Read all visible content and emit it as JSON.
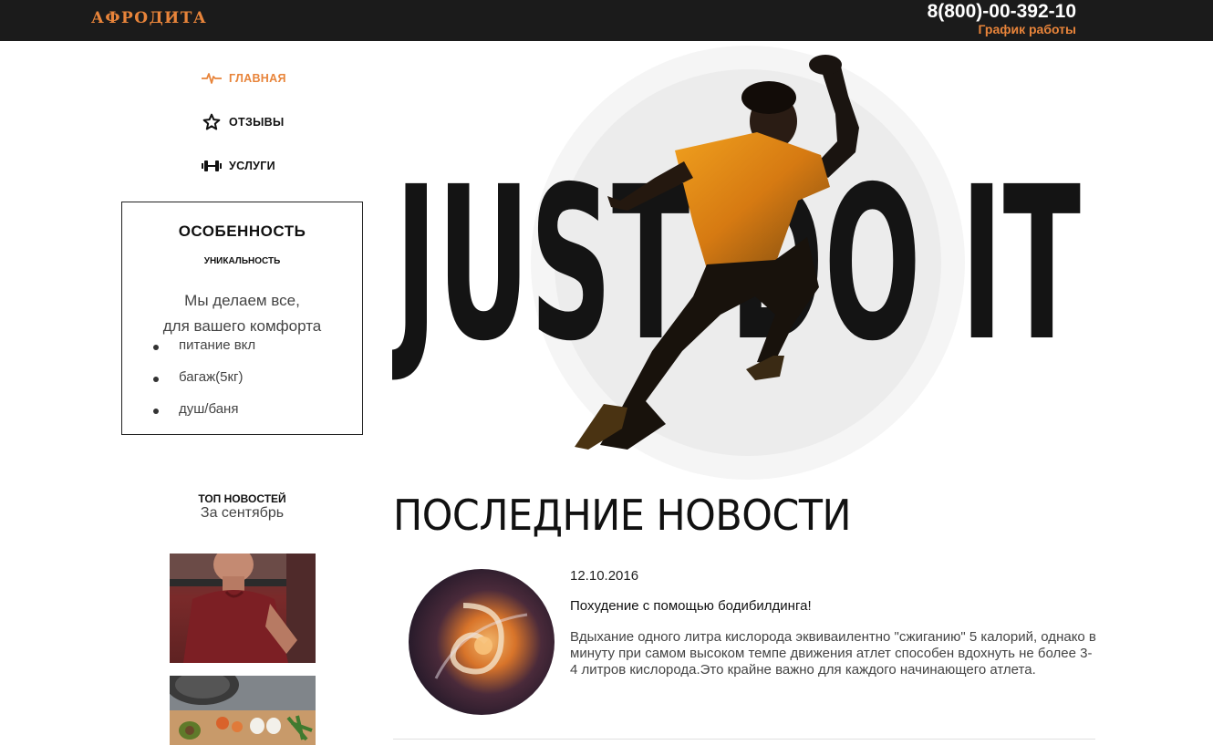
{
  "header": {
    "logo": "АФРОДИТА",
    "phone": "8(800)-00-392-10",
    "schedule_link": "График работы"
  },
  "nav": {
    "items": [
      {
        "label": "ГЛАВНАЯ",
        "icon": "pulse-icon",
        "active": true
      },
      {
        "label": "ОТЗЫВЫ",
        "icon": "star-icon",
        "active": false
      },
      {
        "label": "УСЛУГИ",
        "icon": "dumbbell-icon",
        "active": false
      }
    ]
  },
  "feature": {
    "title": "ОСОБЕННОСТЬ",
    "subtitle": "УНИКАЛЬНОСТЬ",
    "text_line1": "Мы делаем все,",
    "text_line2": "для вашего комфорта",
    "items": [
      "питание вкл",
      "багаж(5кг)",
      "душ/баня"
    ]
  },
  "top_news": {
    "title": "ТОП НОВОСТЕЙ",
    "subtitle": "За сентябрь"
  },
  "hero": {
    "slogan": "JUST DO IT"
  },
  "news": {
    "heading": "ПОСЛЕДНИЕ НОВОСТИ",
    "items": [
      {
        "date": "12.10.2016",
        "title": "Похудение с помощью бодибилдинга!",
        "text": "Вдыхание одного литра кислорода эквиваилентно \"сжиганию\" 5 калорий, однако в минуту при самом высоком темпе движения атлет способен вдохнуть не более 3-4 литров кислорода.Это крайне важно для каждого начинающего атлета."
      }
    ]
  },
  "colors": {
    "accent": "#e8843a",
    "topbar": "#1b1b1b",
    "text_dark": "#111111"
  }
}
